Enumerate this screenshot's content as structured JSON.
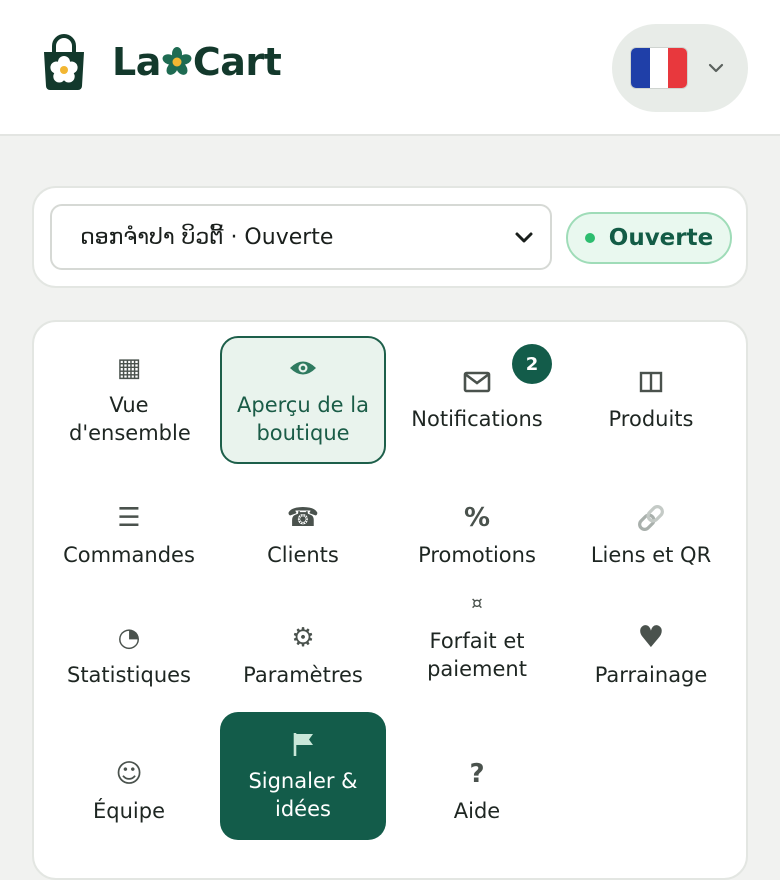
{
  "header": {
    "brand_part1": "La",
    "brand_part2": "Cart",
    "language": "FR"
  },
  "store": {
    "selected": "ດອກຈໍາປາ ບິວຕີ້ · Ouverte",
    "status": "Ouverte"
  },
  "menu": {
    "items": [
      {
        "label": "Vue d'ensemble",
        "icon": "grid-icon"
      },
      {
        "label": "Aperçu de la boutique",
        "icon": "eye-icon"
      },
      {
        "label": "Notifications",
        "icon": "mail-icon",
        "badge": "2"
      },
      {
        "label": "Produits",
        "icon": "columns-icon"
      },
      {
        "label": "Commandes",
        "icon": "list-icon"
      },
      {
        "label": "Clients",
        "icon": "phone-icon"
      },
      {
        "label": "Promotions",
        "icon": "percent-icon"
      },
      {
        "label": "Liens et QR",
        "icon": "link-icon"
      },
      {
        "label": "Statistiques",
        "icon": "pie-icon"
      },
      {
        "label": "Paramètres",
        "icon": "gear-icon"
      },
      {
        "label": "Forfait et paiement",
        "icon": "currency-icon"
      },
      {
        "label": "Parrainage",
        "icon": "heart-icon"
      },
      {
        "label": "Équipe",
        "icon": "smile-icon"
      },
      {
        "label": "Signaler & idées",
        "icon": "flag-icon"
      },
      {
        "label": "Aide",
        "icon": "question-icon"
      }
    ]
  },
  "colors": {
    "brand": "#13392c",
    "accent": "#135c4a",
    "status_green": "#2dbd6f"
  }
}
